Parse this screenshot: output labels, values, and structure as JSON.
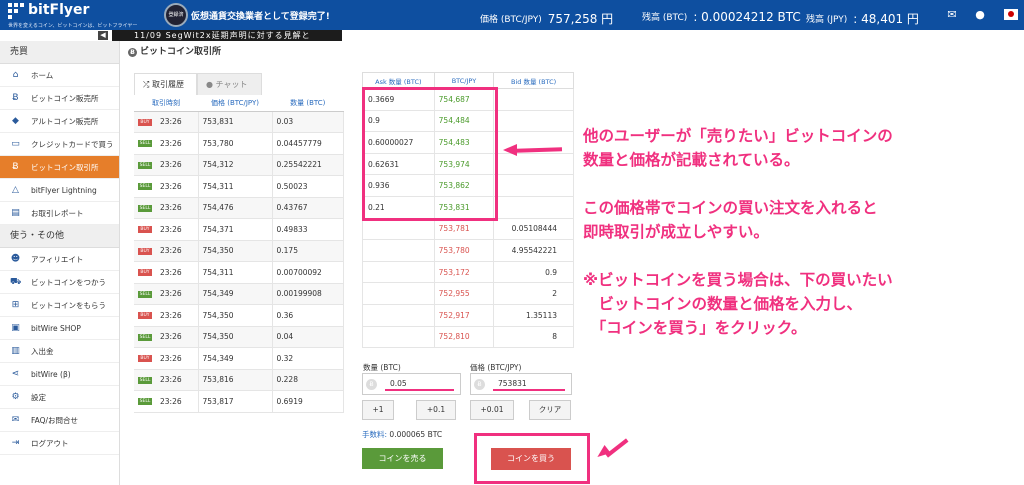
{
  "header": {
    "logo_text": "bitFlyer",
    "tagline": "世界を変えるコイン、ビットコインは、ビットフライヤー",
    "badge_text": "登録済",
    "banner": "仮想通貨交換業者として登録完了!",
    "price_label": "価格 (BTC/JPY)",
    "price_value": "757,258 円",
    "btc_label": "残高 (BTC)",
    "btc_value": ": 0.00024212 BTC",
    "jpy_label": "残高 (JPY)",
    "jpy_value": ": 48,401 円",
    "icons": [
      "mail-icon",
      "user-icon",
      "menu-icon",
      "japan-flag-icon"
    ]
  },
  "subbar": {
    "collapse_glyph": "◀",
    "ticker": "11/09 SegWit2x延期声明に対する見解と"
  },
  "sidebar": {
    "section1": "売買",
    "items1": [
      {
        "label": "ホーム",
        "icon": "home-icon",
        "glyph": "⌂"
      },
      {
        "label": "ビットコイン販売所",
        "icon": "bitcoin-icon",
        "glyph": "Ƀ"
      },
      {
        "label": "アルトコイン販売所",
        "icon": "ether-icon",
        "glyph": "◆"
      },
      {
        "label": "クレジットカードで買う",
        "icon": "credit-card-icon",
        "glyph": "▭"
      },
      {
        "label": "ビットコイン取引所",
        "icon": "bitcoin-icon",
        "glyph": "Ƀ",
        "active": true
      },
      {
        "label": "bitFlyer Lightning",
        "icon": "lightning-icon",
        "glyph": "△"
      },
      {
        "label": "お取引レポート",
        "icon": "report-icon",
        "glyph": "▤"
      }
    ],
    "section2": "使う・その他",
    "items2": [
      {
        "label": "アフィリエイト",
        "icon": "users-icon",
        "glyph": "☻"
      },
      {
        "label": "ビットコインをつかう",
        "icon": "cart-icon",
        "glyph": "⛟"
      },
      {
        "label": "ビットコインをもらう",
        "icon": "gift-icon",
        "glyph": "⊞"
      },
      {
        "label": "bitWire SHOP",
        "icon": "shop-icon",
        "glyph": "▣"
      },
      {
        "label": "入出金",
        "icon": "deposit-icon",
        "glyph": "▥"
      },
      {
        "label": "bitWire (β)",
        "icon": "share-icon",
        "glyph": "⋖"
      },
      {
        "label": "設定",
        "icon": "gear-icon",
        "glyph": "⚙"
      },
      {
        "label": "FAQ/お問合せ",
        "icon": "mail-icon",
        "glyph": "✉"
      },
      {
        "label": "ログアウト",
        "icon": "logout-icon",
        "glyph": "⇥"
      }
    ]
  },
  "main": {
    "title": "ビットコイン取引所",
    "tabs": [
      {
        "label": "取引履歴",
        "icon": "shuffle-icon",
        "glyph": "⤮"
      },
      {
        "label": "チャット",
        "icon": "chat-icon",
        "glyph": "●"
      }
    ],
    "history": {
      "headers": [
        "取引時刻",
        "価格 (BTC/JPY)",
        "数量 (BTC)"
      ],
      "rows": [
        {
          "side": "BUY",
          "time": "23:26",
          "price": "753,831",
          "qty": "0.03"
        },
        {
          "side": "SELL",
          "time": "23:26",
          "price": "753,780",
          "qty": "0.04457779"
        },
        {
          "side": "SELL",
          "time": "23:26",
          "price": "754,312",
          "qty": "0.25542221"
        },
        {
          "side": "SELL",
          "time": "23:26",
          "price": "754,311",
          "qty": "0.50023"
        },
        {
          "side": "SELL",
          "time": "23:26",
          "price": "754,476",
          "qty": "0.43767"
        },
        {
          "side": "BUY",
          "time": "23:26",
          "price": "754,371",
          "qty": "0.49833"
        },
        {
          "side": "BUY",
          "time": "23:26",
          "price": "754,350",
          "qty": "0.175"
        },
        {
          "side": "BUY",
          "time": "23:26",
          "price": "754,311",
          "qty": "0.00700092"
        },
        {
          "side": "SELL",
          "time": "23:26",
          "price": "754,349",
          "qty": "0.00199908"
        },
        {
          "side": "BUY",
          "time": "23:26",
          "price": "754,350",
          "qty": "0.36"
        },
        {
          "side": "SELL",
          "time": "23:26",
          "price": "754,350",
          "qty": "0.04"
        },
        {
          "side": "BUY",
          "time": "23:26",
          "price": "754,349",
          "qty": "0.32"
        },
        {
          "side": "SELL",
          "time": "23:26",
          "price": "753,816",
          "qty": "0.228"
        },
        {
          "side": "SELL",
          "time": "23:26",
          "price": "753,817",
          "qty": "0.6919"
        }
      ]
    },
    "book": {
      "headers": [
        "Ask 数量 (BTC)",
        "BTC/JPY",
        "Bid 数量 (BTC)"
      ],
      "asks": [
        {
          "qty": "0.3669",
          "price": "754,687"
        },
        {
          "qty": "0.9",
          "price": "754,484"
        },
        {
          "qty": "0.60000027",
          "price": "754,483"
        },
        {
          "qty": "0.62631",
          "price": "753,974"
        },
        {
          "qty": "0.936",
          "price": "753,862"
        },
        {
          "qty": "0.21",
          "price": "753,831"
        }
      ],
      "bids": [
        {
          "price": "753,781",
          "qty": "0.05108444"
        },
        {
          "price": "753,780",
          "qty": "4.95542221"
        },
        {
          "price": "753,172",
          "qty": "0.9"
        },
        {
          "price": "752,955",
          "qty": "2"
        },
        {
          "price": "752,917",
          "qty": "1.35113"
        },
        {
          "price": "752,810",
          "qty": "8"
        }
      ]
    },
    "form": {
      "qty_label": "数量 (BTC)",
      "qty_value": "0.05",
      "price_label": "価格 (BTC/JPY)",
      "price_value": "753831",
      "coin_glyph": "Ƀ",
      "step_buttons": [
        "+1",
        "+0.1",
        "+0.01",
        "クリア"
      ],
      "fee_label": "手数料:",
      "fee_value": "0.000065 BTC",
      "sell_button": "コインを売る",
      "buy_button": "コインを買う"
    }
  },
  "annotations": {
    "lines": [
      "他のユーザーが「売りたい」ビットコインの",
      "数量と価格が記載されている。",
      "",
      "この価格帯でコインの買い注文を入れると",
      "即時取引が成立しやすい。",
      "",
      "※ビットコインを買う場合は、下の買いたい",
      "　ビットコインの数量と価格を入力し、",
      "　「コインを買う」をクリック。"
    ],
    "color": "#f0307f"
  },
  "colors": {
    "header_blue": "#0e4fa0",
    "active_orange": "#e67e2a",
    "buy_red": "#d9534f",
    "sell_green": "#5a9a3a",
    "accent_pink": "#f0307f"
  }
}
